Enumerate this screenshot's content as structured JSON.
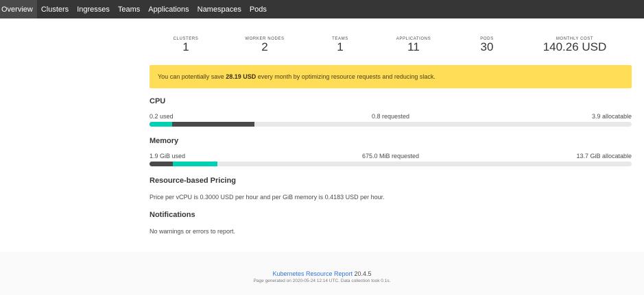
{
  "nav": {
    "items": [
      {
        "label": "Overview"
      },
      {
        "label": "Clusters"
      },
      {
        "label": "Ingresses"
      },
      {
        "label": "Teams"
      },
      {
        "label": "Applications"
      },
      {
        "label": "Namespaces"
      },
      {
        "label": "Pods"
      }
    ],
    "active": "Overview"
  },
  "stats": [
    {
      "label": "Clusters",
      "value": "1"
    },
    {
      "label": "Worker Nodes",
      "value": "2"
    },
    {
      "label": "Teams",
      "value": "1"
    },
    {
      "label": "Applications",
      "value": "11"
    },
    {
      "label": "Pods",
      "value": "30"
    },
    {
      "label": "Monthly Cost",
      "value": "140.26 USD"
    }
  ],
  "notice": {
    "prefix": "You can potentially save ",
    "amount": "28.19 USD",
    "suffix": " every month by optimizing resource requests and reducing slack.",
    "color": "#ffdd57"
  },
  "cpu": {
    "title": "CPU",
    "used_label": "0.2 used",
    "requested_label": "0.8 requested",
    "allocatable_label": "3.9 allocatable",
    "used_fraction": 0.0473,
    "requested_fraction": 0.2176
  },
  "memory": {
    "title": "Memory",
    "used_label": "1.9 GiB used",
    "requested_label": "675.0 MiB requested",
    "allocatable_label": "13.7 GiB allocatable",
    "used_fraction": 0.1409,
    "requested_fraction": 0.0481
  },
  "pricing": {
    "title": "Resource-based Pricing",
    "text": "Price per vCPU is 0.3000 USD per hour and per GiB memory is 0.4183 USD per hour."
  },
  "notifications": {
    "title": "Notifications",
    "text": "No warnings or errors to report."
  },
  "footer": {
    "link_text": "Kubernetes Resource Report",
    "version": "20.4.5",
    "generated": "Page generated on 2020-05-24 12:14 UTC. Data collection took 0.1s."
  },
  "colors": {
    "navbar": "#363636",
    "used": "#00d1b2",
    "requested": "#4a4a4a",
    "track": "#e8e8e8",
    "link": "#3273dc"
  }
}
